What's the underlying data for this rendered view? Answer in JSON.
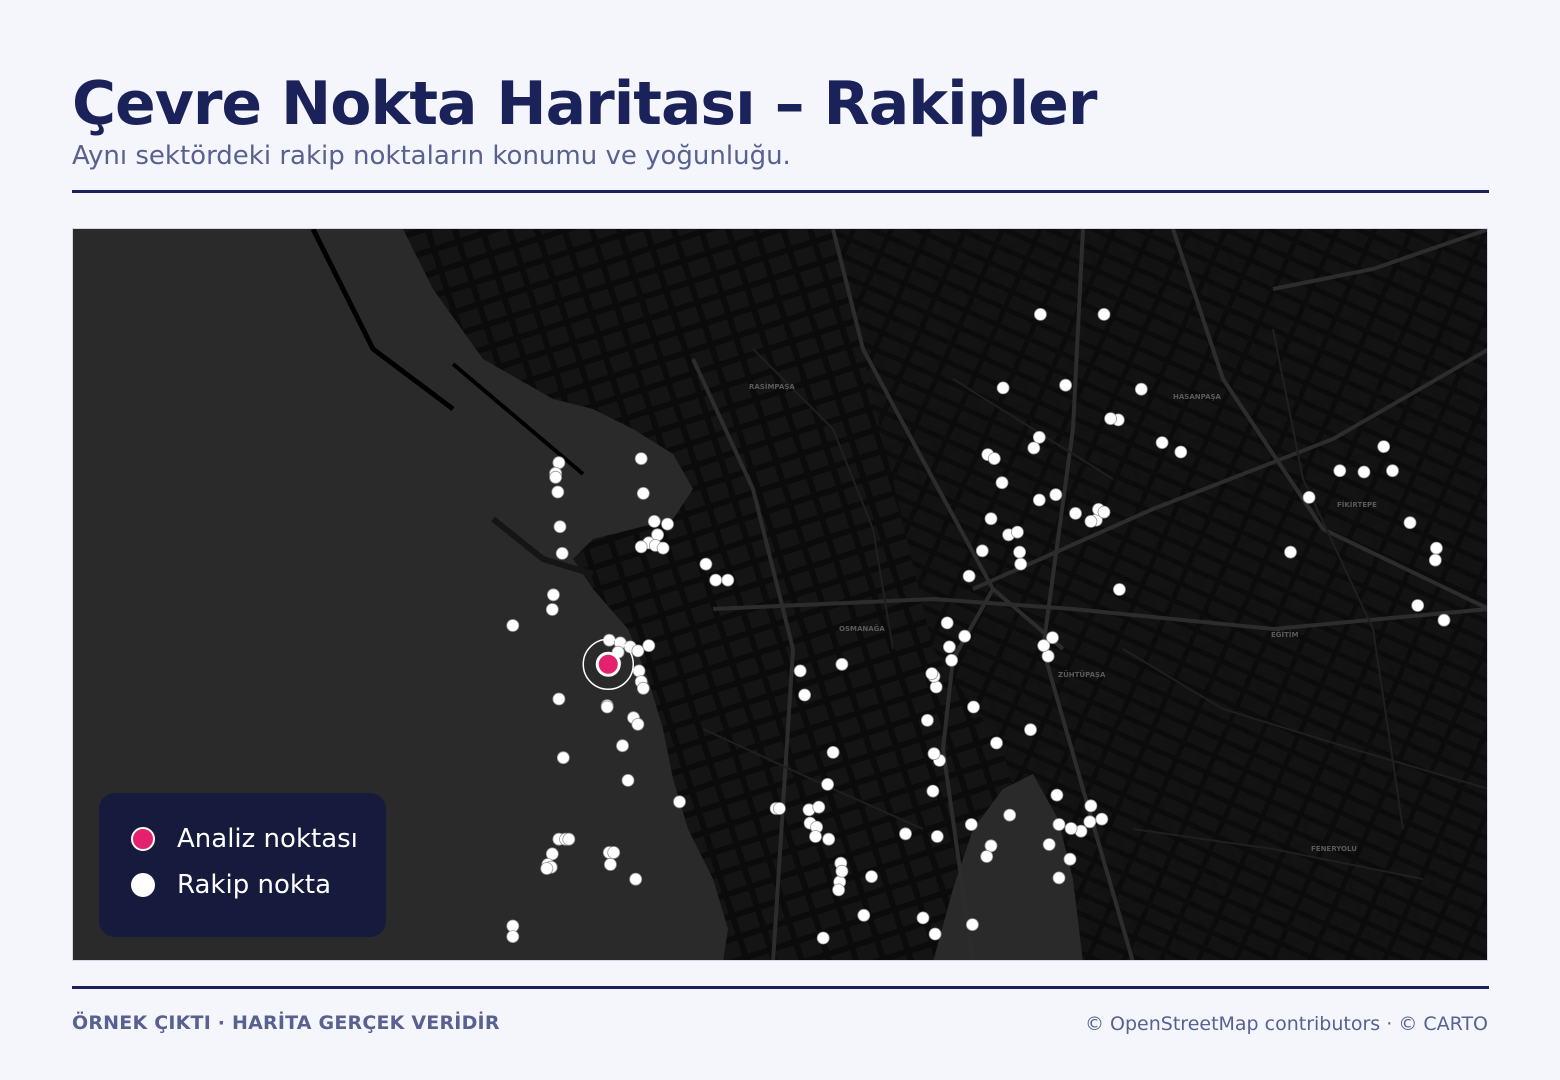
{
  "header": {
    "title": "Çevre Nokta Haritası – Rakipler",
    "subtitle": "Aynı sektördeki rakip noktaların konumu ve yoğunluğu."
  },
  "map": {
    "basemap_style": "dark",
    "analysis_point": {
      "lat": 38.424,
      "lon": 27.1419
    },
    "competitors": [
      [
        38.4502,
        27.1813
      ],
      [
        38.4502,
        27.1871
      ],
      [
        38.4447,
        27.1779
      ],
      [
        38.4449,
        27.1836
      ],
      [
        38.4446,
        27.1905
      ],
      [
        38.4423,
        27.1884
      ],
      [
        38.4424,
        27.1877
      ],
      [
        38.441,
        27.1812
      ],
      [
        38.4402,
        27.1807
      ],
      [
        38.4397,
        27.1765
      ],
      [
        38.4394,
        27.1771
      ],
      [
        38.4363,
        27.1812
      ],
      [
        38.4367,
        27.1827
      ],
      [
        38.4353,
        27.1845
      ],
      [
        38.4348,
        27.1864
      ],
      [
        38.4356,
        27.1866
      ],
      [
        38.4354,
        27.1871
      ],
      [
        38.4347,
        27.1859
      ],
      [
        38.4406,
        27.1924
      ],
      [
        38.4399,
        27.1941
      ],
      [
        38.4385,
        27.2086
      ],
      [
        38.4384,
        27.2108
      ],
      [
        38.4403,
        27.2126
      ],
      [
        38.4385,
        27.2134
      ],
      [
        38.4365,
        27.2058
      ],
      [
        38.4324,
        27.2041
      ],
      [
        38.4346,
        27.215
      ],
      [
        38.4327,
        27.2174
      ],
      [
        38.4318,
        27.2173
      ],
      [
        38.4284,
        27.2157
      ],
      [
        38.4273,
        27.2181
      ],
      [
        38.4296,
        27.1885
      ],
      [
        38.4253,
        27.173
      ],
      [
        38.4243,
        27.1732
      ],
      [
        38.4261,
        27.1744
      ],
      [
        38.4271,
        27.1728
      ],
      [
        38.4391,
        27.1374
      ],
      [
        38.4383,
        27.1371
      ],
      [
        38.438,
        27.1371
      ],
      [
        38.4369,
        27.1373
      ],
      [
        38.4343,
        27.1375
      ],
      [
        38.4323,
        27.1377
      ],
      [
        38.4292,
        27.1369
      ],
      [
        38.4281,
        27.1368
      ],
      [
        38.4269,
        27.1332
      ],
      [
        38.4394,
        27.1449
      ],
      [
        38.4368,
        27.1451
      ],
      [
        38.4347,
        27.1461
      ],
      [
        38.4337,
        27.1464
      ],
      [
        38.4331,
        27.1456
      ],
      [
        38.4329,
        27.1462
      ],
      [
        38.4327,
        27.1469
      ],
      [
        38.4328,
        27.1449
      ],
      [
        38.4345,
        27.1473
      ],
      [
        38.4315,
        27.1508
      ],
      [
        38.4303,
        27.1517
      ],
      [
        38.4303,
        27.1528
      ],
      [
        38.4258,
        27.142
      ],
      [
        38.4256,
        27.143
      ],
      [
        38.4253,
        27.1439
      ],
      [
        38.4249,
        27.1428
      ],
      [
        38.425,
        27.1446
      ],
      [
        38.4254,
        27.1456
      ],
      [
        38.4235,
        27.1447
      ],
      [
        38.4227,
        27.1449
      ],
      [
        38.4222,
        27.1451
      ],
      [
        38.4209,
        27.1418
      ],
      [
        38.4208,
        27.1418
      ],
      [
        38.4241,
        27.1425
      ],
      [
        38.4214,
        27.1374
      ],
      [
        38.42,
        27.1442
      ],
      [
        38.4195,
        27.1446
      ],
      [
        38.4179,
        27.1432
      ],
      [
        38.417,
        27.1378
      ],
      [
        38.4153,
        27.1437
      ],
      [
        38.4137,
        27.1484
      ],
      [
        38.4109,
        27.1374
      ],
      [
        38.4109,
        27.138
      ],
      [
        38.4109,
        27.1383
      ],
      [
        38.4098,
        27.1368
      ],
      [
        38.409,
        27.1364
      ],
      [
        38.4088,
        27.1367
      ],
      [
        38.4087,
        27.1363
      ],
      [
        38.4099,
        27.142
      ],
      [
        38.4099,
        27.1424
      ],
      [
        38.409,
        27.1421
      ],
      [
        38.4079,
        27.1444
      ],
      [
        38.4044,
        27.1332
      ],
      [
        38.4036,
        27.1332
      ],
      [
        38.4235,
        27.1594
      ],
      [
        38.424,
        27.1632
      ],
      [
        38.4217,
        27.1598
      ],
      [
        38.415,
        27.1619
      ],
      [
        38.4174,
        27.1624
      ],
      [
        38.4132,
        27.1572
      ],
      [
        38.4132,
        27.1575
      ],
      [
        38.4131,
        27.1602
      ],
      [
        38.4121,
        27.1603
      ],
      [
        38.4133,
        27.1611
      ],
      [
        38.4118,
        27.1609
      ],
      [
        38.4109,
        27.162
      ],
      [
        38.4111,
        27.1608
      ],
      [
        38.4091,
        27.1631
      ],
      [
        38.4077,
        27.163
      ],
      [
        38.4085,
        27.1632
      ],
      [
        38.4071,
        27.1629
      ],
      [
        38.4052,
        27.1652
      ],
      [
        38.4035,
        27.1615
      ],
      [
        38.4081,
        27.1659
      ],
      [
        38.405,
        27.1706
      ],
      [
        38.4038,
        27.1717
      ],
      [
        38.4113,
        27.169
      ],
      [
        38.4111,
        27.1719
      ],
      [
        38.412,
        27.175
      ],
      [
        38.4145,
        27.1715
      ],
      [
        38.4168,
        27.1721
      ],
      [
        38.4173,
        27.1716
      ],
      [
        38.4198,
        27.171
      ],
      [
        38.4223,
        27.1718
      ],
      [
        38.4231,
        27.1716
      ],
      [
        38.4233,
        27.1714
      ],
      [
        38.4306,
        27.1748
      ],
      [
        38.4325,
        27.176
      ],
      [
        38.4337,
        27.1784
      ],
      [
        38.4339,
        27.1792
      ],
      [
        38.4324,
        27.1794
      ],
      [
        38.4376,
        27.1778
      ],
      [
        38.4349,
        27.1768
      ],
      [
        38.4315,
        27.1795
      ],
      [
        38.426,
        27.1824
      ],
      [
        38.4246,
        27.182
      ],
      [
        38.4254,
        27.1816
      ],
      [
        38.4208,
        27.1752
      ],
      [
        38.4181,
        27.1773
      ],
      [
        38.4191,
        27.1804
      ],
      [
        38.4142,
        27.1828
      ],
      [
        38.4127,
        27.1785
      ],
      [
        38.4104,
        27.1768
      ],
      [
        38.4096,
        27.1764
      ],
      [
        38.4094,
        27.184
      ],
      [
        38.4105,
        27.1821
      ],
      [
        38.4115,
        27.185
      ],
      [
        38.4134,
        27.1859
      ],
      [
        38.4122,
        27.1858
      ],
      [
        38.4117,
        27.1841
      ],
      [
        38.4124,
        27.1869
      ],
      [
        38.4045,
        27.1751
      ],
      [
        38.412,
        27.183
      ],
      [
        38.408,
        27.183
      ]
    ],
    "place_labels": [
      "RASİMPAŞA",
      "HASANPAŞA",
      "OSMANAĞA",
      "ZÜHTÜPAŞA",
      "FİKİRTEPE",
      "EĞİTİM",
      "FENERYOLU"
    ]
  },
  "legend": {
    "analysis_label": "Analiz noktası",
    "competitor_label": "Rakip nokta"
  },
  "colors": {
    "analysis": "#e5206f",
    "competitor": "#ffffff",
    "title": "#1b2159",
    "muted": "#58618f",
    "legend_bg": "#161a3c"
  },
  "footer": {
    "left": "ÖRNEK ÇIKTI · HARİTA GERÇEK VERİDİR",
    "right": "© OpenStreetMap contributors · © CARTO"
  }
}
